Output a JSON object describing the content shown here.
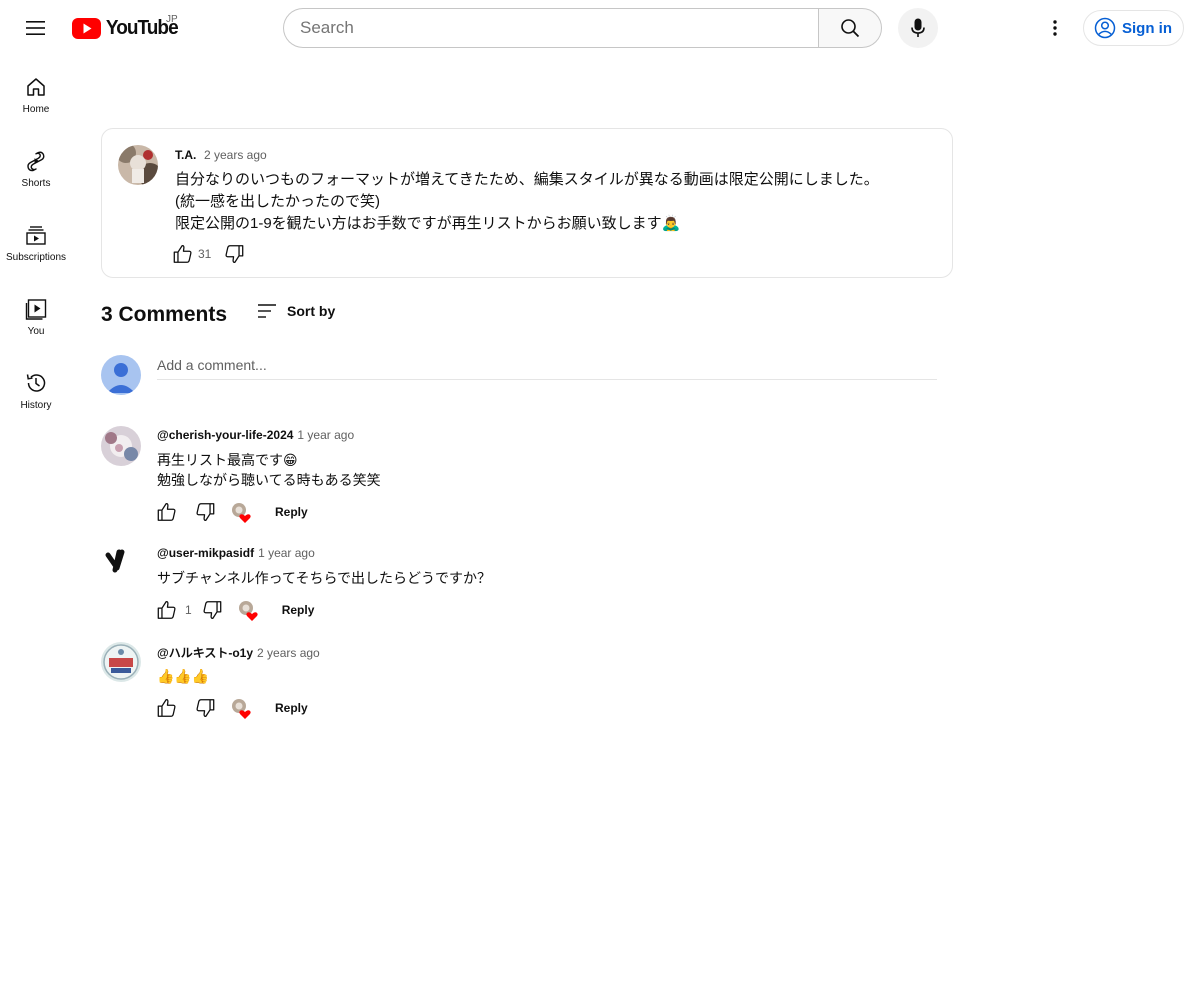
{
  "header": {
    "logo_text": "YouTube",
    "region": "JP",
    "search_placeholder": "Search",
    "signin_label": "Sign in",
    "brand_color": "#ff0000",
    "link_color": "#065fd4"
  },
  "sidebar": {
    "items": [
      {
        "label": "Home",
        "icon": "home-icon"
      },
      {
        "label": "Shorts",
        "icon": "shorts-icon"
      },
      {
        "label": "Subscriptions",
        "icon": "subscriptions-icon"
      },
      {
        "label": "You",
        "icon": "you-icon"
      },
      {
        "label": "History",
        "icon": "history-icon"
      }
    ]
  },
  "post": {
    "author": "T.A.",
    "time": "2 years ago",
    "lines": [
      "自分なりのいつものフォーマットが増えてきたため、編集スタイルが異なる動画は限定公開にしました。",
      "(統一感を出したかったので笑)",
      "限定公開の1-9を観たい方はお手数ですが再生リストからお願い致します🙇‍♂️"
    ],
    "likes": "31"
  },
  "comments_section": {
    "title": "3 Comments",
    "sort_label": "Sort by",
    "add_placeholder": "Add a comment..."
  },
  "comments": [
    {
      "author": "@cherish-your-life-2024",
      "time": "1 year ago",
      "lines": [
        "再生リスト最高です😁",
        "勉強しながら聴いてる時もある笑笑"
      ],
      "likes": "",
      "reply_label": "Reply"
    },
    {
      "author": "@user-mikpasidf",
      "time": "1 year ago",
      "lines": [
        "サブチャンネル作ってそちらで出したらどうですか？"
      ],
      "likes": "1",
      "reply_label": "Reply"
    },
    {
      "author": "@ハルキスト-o1y",
      "time": "2 years ago",
      "lines": [
        "👍👍👍"
      ],
      "likes": "",
      "reply_label": "Reply"
    }
  ]
}
